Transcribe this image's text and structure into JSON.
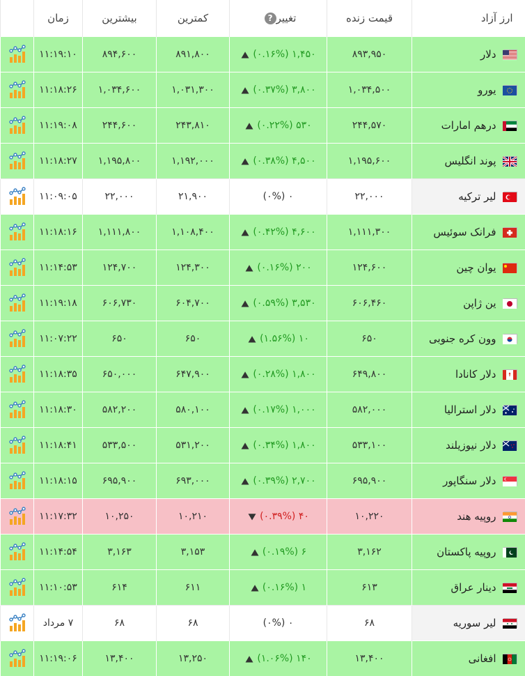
{
  "header": {
    "name": "ارز آزاد",
    "price": "قیمت زنده",
    "change": "تغییر",
    "change_help": "?",
    "low": "کمترین",
    "high": "بیشترین",
    "time": "زمان"
  },
  "rows": [
    {
      "name": "دلار",
      "flag": "flag-us-icon",
      "trend": "up",
      "price": "۸۹۳,۹۵۰",
      "change": "۱,۴۵۰ (۰.۱۶%)",
      "low": "۸۹۱,۸۰۰",
      "high": "۸۹۴,۶۰۰",
      "time": "۱۱:۱۹:۱۰"
    },
    {
      "name": "یورو",
      "flag": "flag-eu-icon",
      "trend": "up",
      "price": "۱,۰۳۴,۵۰۰",
      "change": "۳,۸۰۰ (۰.۳۷%)",
      "low": "۱,۰۳۱,۳۰۰",
      "high": "۱,۰۳۴,۶۰۰",
      "time": "۱۱:۱۸:۲۶"
    },
    {
      "name": "درهم امارات",
      "flag": "flag-ae-icon",
      "trend": "up",
      "price": "۲۴۴,۵۷۰",
      "change": "۵۳۰ (۰.۲۲%)",
      "low": "۲۴۳,۸۱۰",
      "high": "۲۴۴,۶۰۰",
      "time": "۱۱:۱۹:۰۸"
    },
    {
      "name": "پوند انگلیس",
      "flag": "flag-gb-icon",
      "trend": "up",
      "price": "۱,۱۹۵,۶۰۰",
      "change": "۴,۵۰۰ (۰.۳۸%)",
      "low": "۱,۱۹۲,۰۰۰",
      "high": "۱,۱۹۵,۸۰۰",
      "time": "۱۱:۱۸:۲۷"
    },
    {
      "name": "لیر ترکیه",
      "flag": "flag-tr-icon",
      "trend": "flat",
      "price": "۲۲,۰۰۰",
      "change": "۰ (۰%)",
      "low": "۲۱,۹۰۰",
      "high": "۲۲,۰۰۰",
      "time": "۱۱:۰۹:۰۵"
    },
    {
      "name": "فرانک سوئیس",
      "flag": "flag-ch-icon",
      "trend": "up",
      "price": "۱,۱۱۱,۳۰۰",
      "change": "۴,۶۰۰ (۰.۴۲%)",
      "low": "۱,۱۰۸,۴۰۰",
      "high": "۱,۱۱۱,۸۰۰",
      "time": "۱۱:۱۸:۱۶"
    },
    {
      "name": "یوان چین",
      "flag": "flag-cn-icon",
      "trend": "up",
      "price": "۱۲۴,۶۰۰",
      "change": "۲۰۰ (۰.۱۶%)",
      "low": "۱۲۴,۳۰۰",
      "high": "۱۲۴,۷۰۰",
      "time": "۱۱:۱۴:۵۳"
    },
    {
      "name": "ین ژاپن",
      "flag": "flag-jp-icon",
      "trend": "up",
      "price": "۶۰۶,۴۶۰",
      "change": "۳,۵۳۰ (۰.۵۹%)",
      "low": "۶۰۴,۷۰۰",
      "high": "۶۰۶,۷۳۰",
      "time": "۱۱:۱۹:۱۸"
    },
    {
      "name": "وون کره جنوبی",
      "flag": "flag-kr-icon",
      "trend": "up",
      "price": "۶۵۰",
      "change": "۱۰ (۱.۵۶%)",
      "low": "۶۵۰",
      "high": "۶۵۰",
      "time": "۱۱:۰۷:۲۲"
    },
    {
      "name": "دلار کانادا",
      "flag": "flag-ca-icon",
      "trend": "up",
      "price": "۶۴۹,۸۰۰",
      "change": "۱,۸۰۰ (۰.۲۸%)",
      "low": "۶۴۷,۹۰۰",
      "high": "۶۵۰,۰۰۰",
      "time": "۱۱:۱۸:۳۵"
    },
    {
      "name": "دلار استرالیا",
      "flag": "flag-au-icon",
      "trend": "up",
      "price": "۵۸۲,۰۰۰",
      "change": "۱,۰۰۰ (۰.۱۷%)",
      "low": "۵۸۰,۱۰۰",
      "high": "۵۸۲,۲۰۰",
      "time": "۱۱:۱۸:۳۰"
    },
    {
      "name": "دلار نیوزیلند",
      "flag": "flag-nz-icon",
      "trend": "up",
      "price": "۵۳۳,۱۰۰",
      "change": "۱,۸۰۰ (۰.۳۴%)",
      "low": "۵۳۱,۲۰۰",
      "high": "۵۳۳,۵۰۰",
      "time": "۱۱:۱۸:۴۱"
    },
    {
      "name": "دلار سنگاپور",
      "flag": "flag-sg-icon",
      "trend": "up",
      "price": "۶۹۵,۹۰۰",
      "change": "۲,۷۰۰ (۰.۳۹%)",
      "low": "۶۹۳,۰۰۰",
      "high": "۶۹۵,۹۰۰",
      "time": "۱۱:۱۸:۱۵"
    },
    {
      "name": "روپیه هند",
      "flag": "flag-in-icon",
      "trend": "down",
      "price": "۱۰,۲۲۰",
      "change": "۴۰ (۰.۳۹%)",
      "low": "۱۰,۲۱۰",
      "high": "۱۰,۲۵۰",
      "time": "۱۱:۱۷:۳۲"
    },
    {
      "name": "روپیه پاکستان",
      "flag": "flag-pk-icon",
      "trend": "up",
      "price": "۳,۱۶۲",
      "change": "۶ (۰.۱۹%)",
      "low": "۳,۱۵۳",
      "high": "۳,۱۶۳",
      "time": "۱۱:۱۴:۵۴"
    },
    {
      "name": "دینار عراق",
      "flag": "flag-iq-icon",
      "trend": "up",
      "price": "۶۱۳",
      "change": "۱ (۰.۱۶%)",
      "low": "۶۱۱",
      "high": "۶۱۴",
      "time": "۱۱:۱۰:۵۳"
    },
    {
      "name": "لیر سوریه",
      "flag": "flag-sy-icon",
      "trend": "flat",
      "price": "۶۸",
      "change": "۰ (۰%)",
      "low": "۶۸",
      "high": "۶۸",
      "time": "۷ مرداد"
    },
    {
      "name": "افغانی",
      "flag": "flag-af-icon",
      "trend": "up",
      "price": "۱۳,۴۰۰",
      "change": "۱۴۰ (۱.۰۶%)",
      "low": "۱۳,۲۵۰",
      "high": "۱۳,۴۰۰",
      "time": "۱۱:۱۹:۰۶"
    }
  ],
  "icons": {
    "up": "chevron-up-icon",
    "down": "chevron-down-icon",
    "chart": "chart-icon"
  },
  "colors": {
    "up_bg": "#a9f4a3",
    "down_bg": "#f7c0c6",
    "up_text": "#229a22",
    "down_text": "#d12020",
    "chart_bar": "#f5a623",
    "chart_line": "#3b82c4"
  }
}
